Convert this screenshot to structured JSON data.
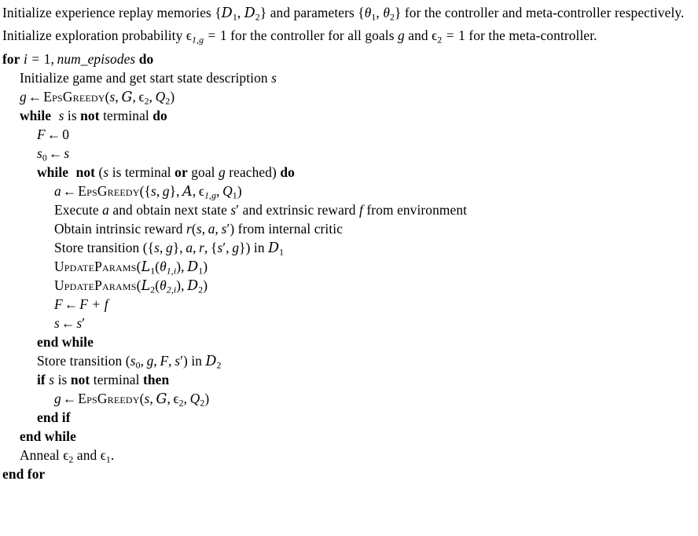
{
  "document": {
    "type": "algorithm-pseudocode",
    "title": "Hierarchical DQN training loop",
    "background_color": "#ffffff",
    "text_color": "#000000"
  },
  "lines": [
    {
      "id": "init-memories",
      "indent": 0,
      "wrapped": true,
      "text": "Initialize experience replay memories {D1, D2} and parameters {θ1, θ2} for the controller and meta-controller respectively."
    },
    {
      "id": "init-exploration",
      "indent": 0,
      "wrapped": true,
      "text": "Initialize exploration probability ε1,g = 1 for the controller for all goals g and ε2 = 1 for the meta-controller."
    },
    {
      "id": "for-episodes",
      "indent": 0,
      "text": "for i = 1, num_episodes do"
    },
    {
      "id": "init-game",
      "indent": 1,
      "text": "Initialize game and get start state description s"
    },
    {
      "id": "goal-epsgreedy",
      "indent": 1,
      "text": "g ← EPSGREEDY(s, G, ε2, Q2)"
    },
    {
      "id": "while-not-terminal",
      "indent": 1,
      "text": "while s is not terminal do"
    },
    {
      "id": "f-zero",
      "indent": 2,
      "text": "F ← 0"
    },
    {
      "id": "s0-assign",
      "indent": 2,
      "text": "s0 ← s"
    },
    {
      "id": "while-not-goal",
      "indent": 2,
      "text": "while not (s is terminal or goal g reached) do"
    },
    {
      "id": "action-epsgreedy",
      "indent": 3,
      "text": "a ← EPSGREEDY({s, g}, A, ε1,g, Q1)"
    },
    {
      "id": "execute-action",
      "indent": 3,
      "text": "Execute a and obtain next state s′ and extrinsic reward f from environment"
    },
    {
      "id": "intrinsic-reward",
      "indent": 3,
      "text": "Obtain intrinsic reward r(s, a, s′) from internal critic"
    },
    {
      "id": "store-transition-d1",
      "indent": 3,
      "text": "Store transition ({s, g}, a, r, {s′, g}) in D1"
    },
    {
      "id": "update-params-1",
      "indent": 3,
      "text": "UPDATEPARAMS(L1(θ1,i), D1)"
    },
    {
      "id": "update-params-2",
      "indent": 3,
      "text": "UPDATEPARAMS(L2(θ2,i), D2)"
    },
    {
      "id": "accumulate-f",
      "indent": 3,
      "text": "F ← F + f"
    },
    {
      "id": "advance-state",
      "indent": 3,
      "text": "s ← s′"
    },
    {
      "id": "end-while-inner",
      "indent": 2,
      "text": "end while"
    },
    {
      "id": "store-transition-d2",
      "indent": 2,
      "text": "Store transition (s0, g, F, s′) in D2"
    },
    {
      "id": "if-not-terminal",
      "indent": 2,
      "text": "if s is not terminal then"
    },
    {
      "id": "goal-epsgreedy-2",
      "indent": 3,
      "text": "g ← EPSGREEDY(s, G, ε2, Q2)"
    },
    {
      "id": "end-if",
      "indent": 2,
      "text": "end if"
    },
    {
      "id": "end-while-outer",
      "indent": 1,
      "text": "end while"
    },
    {
      "id": "anneal",
      "indent": 1,
      "text": "Anneal ε2 and ε1."
    },
    {
      "id": "end-for",
      "indent": 0,
      "text": "end for"
    }
  ],
  "symbols": {
    "assign_arrow": "←",
    "epsilon": "ϵ",
    "theta": "θ",
    "prime": "′",
    "cal_D": "𝒟",
    "cal_G": "𝒢",
    "cal_A": "𝒜",
    "cal_L": "ℒ"
  },
  "procedures": {
    "eps_greedy": "EpsGreedy",
    "update_params": "UpdateParams"
  },
  "keywords": {
    "for": "for",
    "do": "do",
    "while": "while",
    "not": "not",
    "or": "or",
    "if": "if",
    "then": "then",
    "end_if": "end if",
    "end_while": "end while",
    "end_for": "end for"
  }
}
